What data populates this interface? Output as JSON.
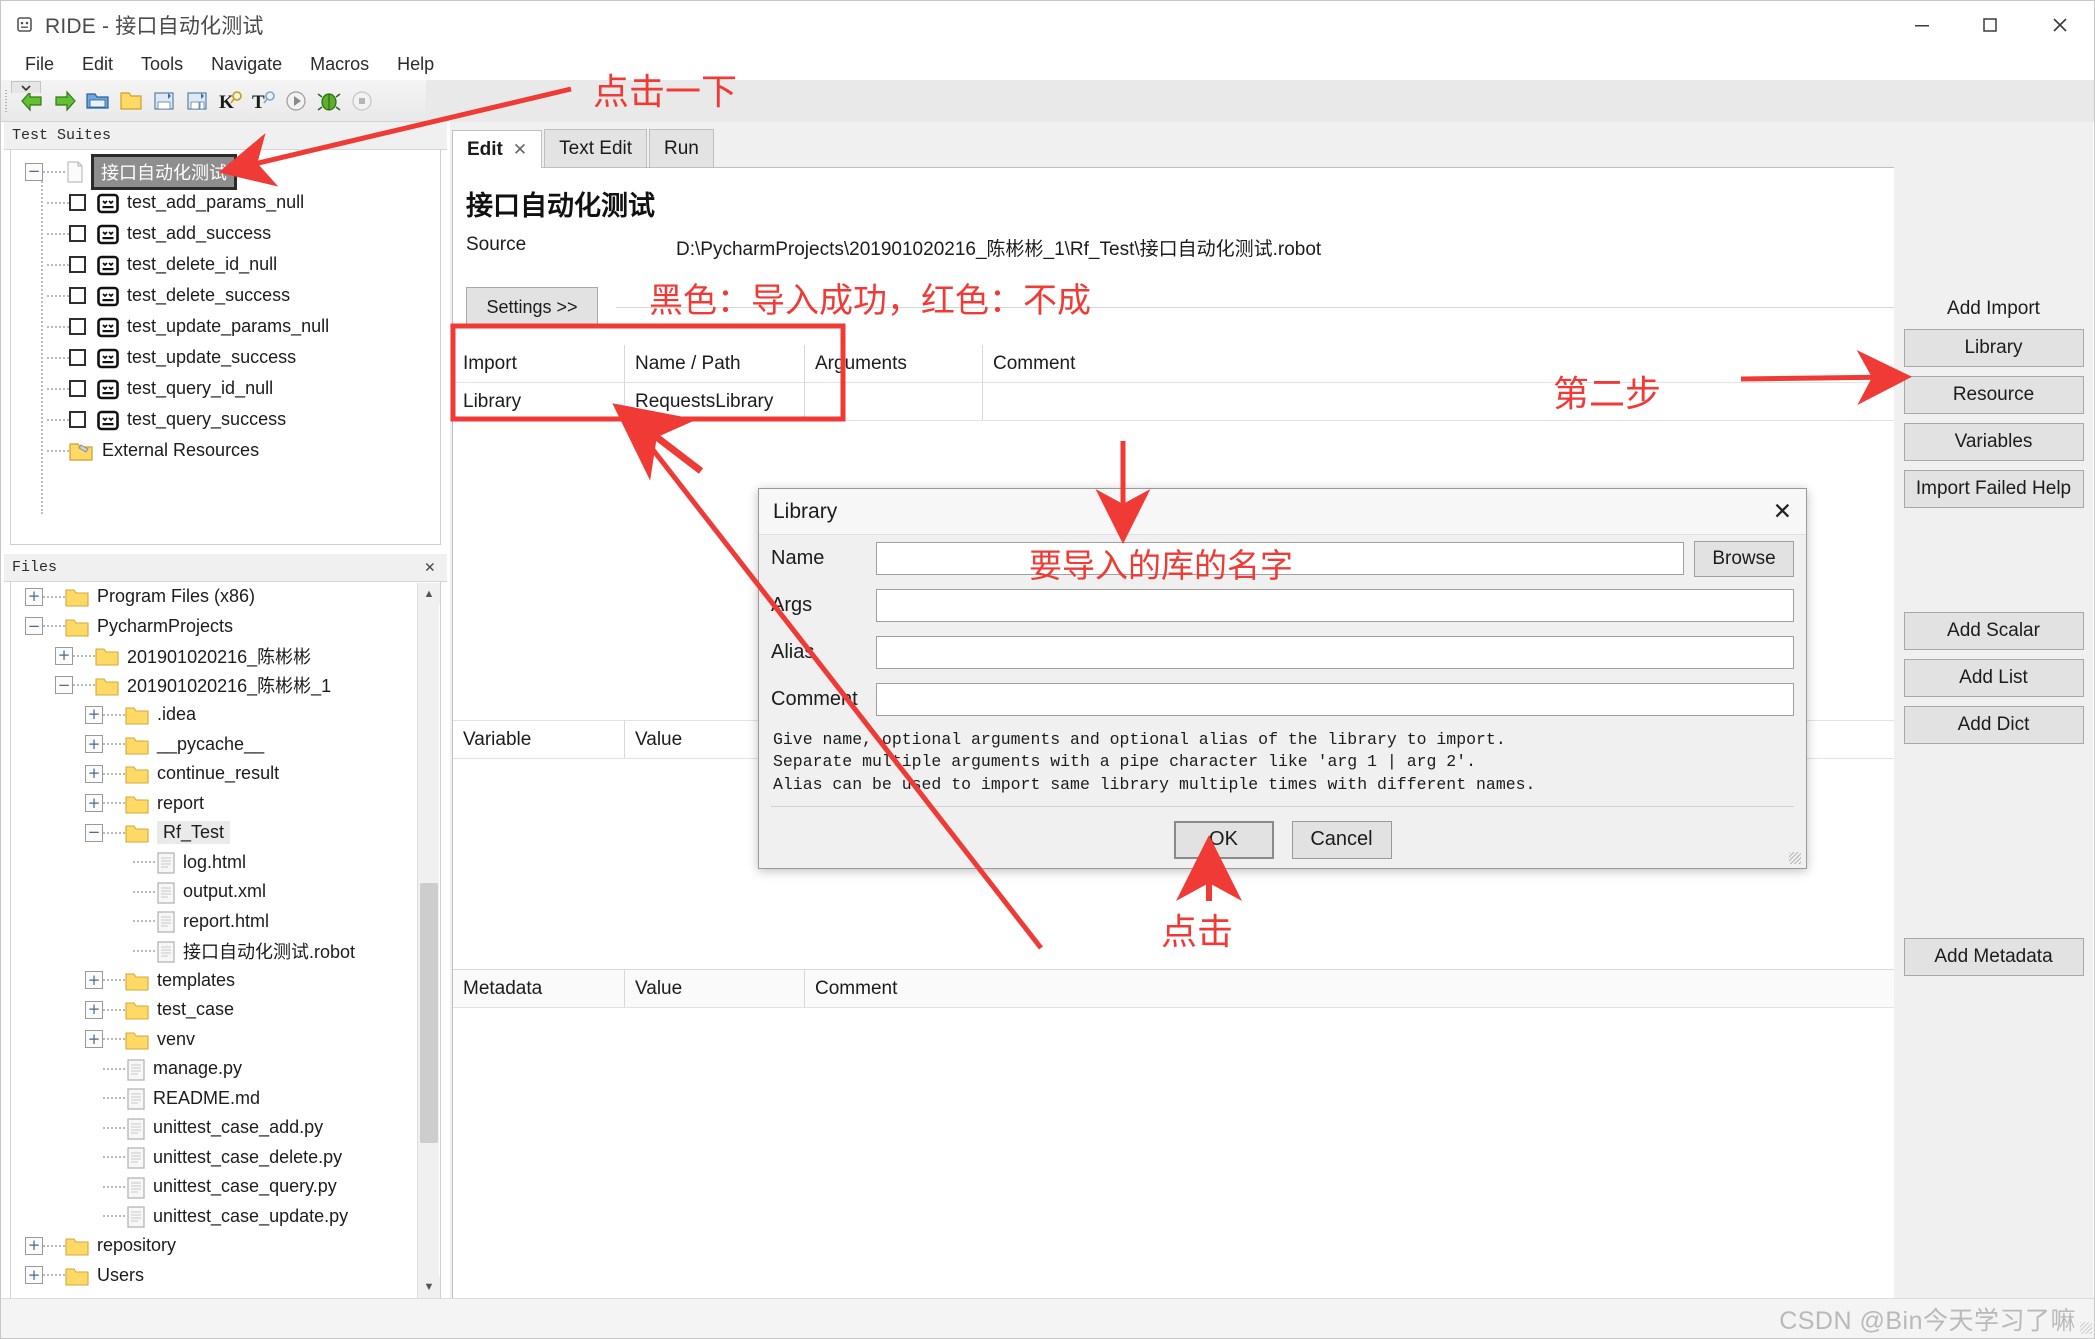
{
  "window": {
    "title": "RIDE - 接口自动化测试",
    "icon": "robot-icon",
    "minimize": "minimize-icon",
    "maximize": "maximize-icon",
    "close": "close-icon"
  },
  "menubar": {
    "items": [
      "File",
      "Edit",
      "Tools",
      "Navigate",
      "Macros",
      "Help"
    ]
  },
  "toolbar": {
    "icons": [
      "back-arrow-icon",
      "forward-arrow-icon",
      "open-folder-icon",
      "new-folder-icon",
      "save-icon",
      "save-all-icon",
      "search-keyword-icon",
      "search-test-icon",
      "run-icon",
      "debug-icon",
      "stop-icon"
    ]
  },
  "suites_panel": {
    "header": "Test Suites",
    "root": "接口自动化测试",
    "tests": [
      "test_add_params_null",
      "test_add_success",
      "test_delete_id_null",
      "test_delete_success",
      "test_update_params_null",
      "test_update_success",
      "test_query_id_null",
      "test_query_success"
    ],
    "external": "External Resources"
  },
  "files_panel": {
    "header": "Files",
    "close": "close-icon",
    "items": [
      {
        "label": "Program Files (x86)",
        "indent": 0,
        "type": "folder",
        "toggle": "+"
      },
      {
        "label": "PycharmProjects",
        "indent": 0,
        "type": "folder",
        "toggle": "-"
      },
      {
        "label": "201901020216_陈彬彬",
        "indent": 1,
        "type": "folder",
        "toggle": "+"
      },
      {
        "label": "201901020216_陈彬彬_1",
        "indent": 1,
        "type": "folder",
        "toggle": "-"
      },
      {
        "label": ".idea",
        "indent": 2,
        "type": "folder",
        "toggle": "+"
      },
      {
        "label": "__pycache__",
        "indent": 2,
        "type": "folder",
        "toggle": "+"
      },
      {
        "label": "continue_result",
        "indent": 2,
        "type": "folder",
        "toggle": "+"
      },
      {
        "label": "report",
        "indent": 2,
        "type": "folder",
        "toggle": "+"
      },
      {
        "label": "Rf_Test",
        "indent": 2,
        "type": "folder",
        "toggle": "-",
        "selected": true
      },
      {
        "label": "log.html",
        "indent": 3,
        "type": "file",
        "toggle": ""
      },
      {
        "label": "output.xml",
        "indent": 3,
        "type": "file",
        "toggle": ""
      },
      {
        "label": "report.html",
        "indent": 3,
        "type": "file",
        "toggle": ""
      },
      {
        "label": "接口自动化测试.robot",
        "indent": 3,
        "type": "file",
        "toggle": ""
      },
      {
        "label": "templates",
        "indent": 2,
        "type": "folder",
        "toggle": "+"
      },
      {
        "label": "test_case",
        "indent": 2,
        "type": "folder",
        "toggle": "+"
      },
      {
        "label": "venv",
        "indent": 2,
        "type": "folder",
        "toggle": "+"
      },
      {
        "label": "manage.py",
        "indent": 2,
        "type": "file",
        "toggle": ""
      },
      {
        "label": "README.md",
        "indent": 2,
        "type": "file",
        "toggle": ""
      },
      {
        "label": "unittest_case_add.py",
        "indent": 2,
        "type": "file",
        "toggle": ""
      },
      {
        "label": "unittest_case_delete.py",
        "indent": 2,
        "type": "file",
        "toggle": ""
      },
      {
        "label": "unittest_case_query.py",
        "indent": 2,
        "type": "file",
        "toggle": ""
      },
      {
        "label": "unittest_case_update.py",
        "indent": 2,
        "type": "file",
        "toggle": ""
      },
      {
        "label": "repository",
        "indent": 0,
        "type": "folder",
        "toggle": "+"
      },
      {
        "label": "Users",
        "indent": 0,
        "type": "folder",
        "toggle": "+"
      }
    ]
  },
  "editor": {
    "tabs": [
      {
        "label": "Edit",
        "active": true,
        "closable": true
      },
      {
        "label": "Text Edit",
        "active": false,
        "closable": false
      },
      {
        "label": "Run",
        "active": false,
        "closable": false
      }
    ],
    "doc_title": "接口自动化测试",
    "source_label": "Source",
    "source_value": "D:\\PycharmProjects\\201901020216_陈彬彬_1\\Rf_Test\\接口自动化测试.robot",
    "settings_button": "Settings >>",
    "import_grid": {
      "headers": [
        "Import",
        "Name / Path",
        "Arguments",
        "Comment"
      ],
      "rows": [
        [
          "Library",
          "RequestsLibrary",
          "",
          ""
        ]
      ]
    },
    "variable_grid": {
      "headers": [
        "Variable",
        "Value"
      ]
    },
    "metadata_grid": {
      "headers": [
        "Metadata",
        "Value",
        "Comment"
      ]
    }
  },
  "rightbar": {
    "add_import_title": "Add Import",
    "import_buttons": [
      "Library",
      "Resource",
      "Variables",
      "Import Failed Help"
    ],
    "variable_buttons": [
      "Add Scalar",
      "Add List",
      "Add Dict"
    ],
    "metadata_button": "Add Metadata"
  },
  "dialog": {
    "title": "Library",
    "close": "close-icon",
    "fields": [
      {
        "label": "Name",
        "value": ""
      },
      {
        "label": "Args",
        "value": ""
      },
      {
        "label": "Alias",
        "value": ""
      },
      {
        "label": "Comment",
        "value": ""
      }
    ],
    "browse": "Browse",
    "help_lines": [
      "Give name, optional arguments and optional alias of the library to import.",
      "Separate multiple arguments with a pipe character like 'arg 1 | arg 2'.",
      "Alias can be used to import same library multiple times with different names."
    ],
    "ok": "OK",
    "cancel": "Cancel"
  },
  "annotations": {
    "color": "#ef3a36",
    "click_once": "点击一下",
    "color_legend": "黑色：导入成功，红色：不成",
    "step_two": "第二步",
    "library_name_hint": "要导入的库的名字",
    "click": "点击"
  },
  "statusbar": {
    "watermark": "CSDN @Bin今天学习了嘛"
  }
}
